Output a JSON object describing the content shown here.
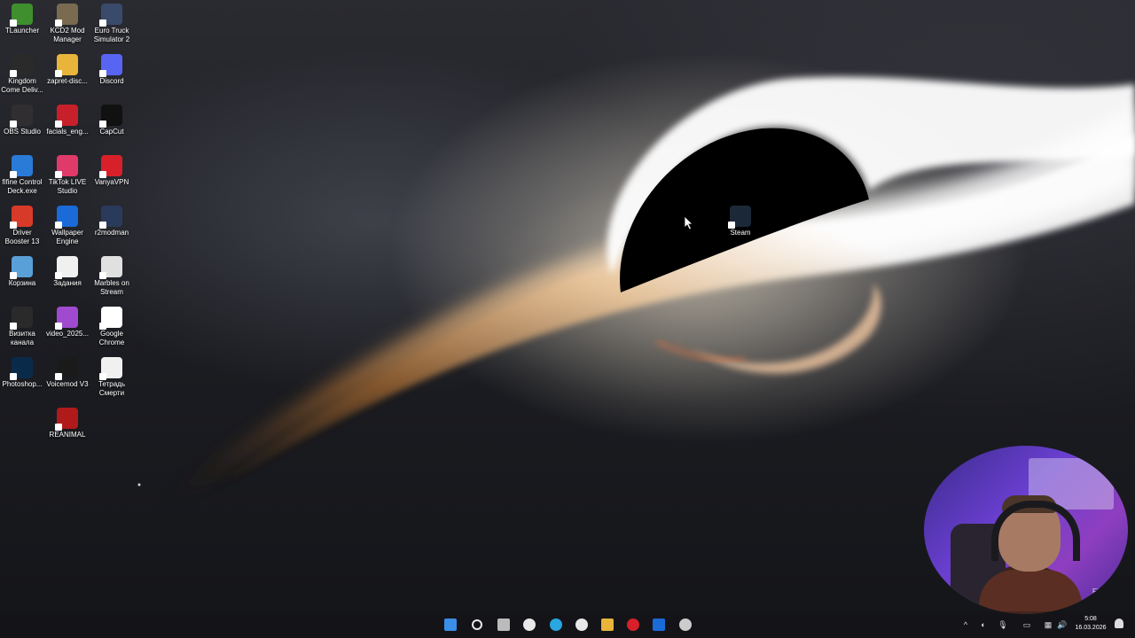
{
  "desktop": {
    "icons": [
      {
        "label": "TLauncher",
        "icon": "tlauncher-icon",
        "color": "#3f8f2f"
      },
      {
        "label": "KCD2 Mod Manager",
        "icon": "gear-icon",
        "color": "#7a6a50"
      },
      {
        "label": "Euro Truck Simulator 2",
        "icon": "truck-icon",
        "color": "#3a4a6a"
      },
      {
        "label": "Kingdom Come Deliv...",
        "icon": "kingdom-come-icon",
        "color": "#2a2a2a"
      },
      {
        "label": "zapret-disc...",
        "icon": "folder-icon",
        "color": "#e8b43a"
      },
      {
        "label": "Discord",
        "icon": "discord-icon",
        "color": "#5865f2"
      },
      {
        "label": "OBS Studio",
        "icon": "obs-icon",
        "color": "#302e31"
      },
      {
        "label": "facials_eng...",
        "icon": "document-icon",
        "color": "#c8202a"
      },
      {
        "label": "CapCut",
        "icon": "capcut-icon",
        "color": "#111111"
      },
      {
        "label": "fifine Control Deck.exe",
        "icon": "fifine-icon",
        "color": "#2a7ad8"
      },
      {
        "label": "TikTok LIVE Studio",
        "icon": "tiktok-icon",
        "color": "#e03a6a"
      },
      {
        "label": "VanyaVPN",
        "icon": "vpn-icon",
        "color": "#d8202a"
      },
      {
        "label": "Driver Booster 13",
        "icon": "driver-booster-icon",
        "color": "#d83a2a"
      },
      {
        "label": "Wallpaper Engine",
        "icon": "wallpaper-engine-icon",
        "color": "#1a6ad8"
      },
      {
        "label": "r2modman",
        "icon": "r2modman-icon",
        "color": "#2a3a5a"
      },
      {
        "label": "Корзина",
        "icon": "recycle-bin-icon",
        "color": "#5aa0d8"
      },
      {
        "label": "Задания",
        "icon": "text-file-icon",
        "color": "#f0f0f0"
      },
      {
        "label": "Marbles on Stream",
        "icon": "marbles-icon",
        "color": "#e0e0e0"
      },
      {
        "label": "Визитка канала",
        "icon": "video-file-icon",
        "color": "#2a2a2a"
      },
      {
        "label": "video_2025...",
        "icon": "video-thumbnail-icon",
        "color": "#a04ad0"
      },
      {
        "label": "Google Chrome",
        "icon": "chrome-icon",
        "color": "#ffffff"
      },
      {
        "label": "Photoshop...",
        "icon": "photoshop-icon",
        "color": "#0a2a4a"
      },
      {
        "label": "Voicemod V3",
        "icon": "voicemod-icon",
        "color": "#1a1a1a"
      },
      {
        "label": "Тетрадь Смерти",
        "icon": "word-document-icon",
        "color": "#f0f0f0"
      },
      {
        "label": "REANIMAL",
        "icon": "reanimal-icon",
        "color": "#b01a1a"
      },
      {
        "label": "Steam",
        "icon": "steam-icon",
        "color": "#1b2838"
      }
    ]
  },
  "taskbar": {
    "items": [
      {
        "name": "start",
        "icon": "windows-start-icon"
      },
      {
        "name": "search",
        "icon": "search-icon"
      },
      {
        "name": "task-view",
        "icon": "task-view-icon"
      },
      {
        "name": "chrome",
        "icon": "chrome-icon"
      },
      {
        "name": "telegram",
        "icon": "telegram-icon"
      },
      {
        "name": "yandex-browser",
        "icon": "yandex-icon"
      },
      {
        "name": "file-explorer",
        "icon": "folder-icon"
      },
      {
        "name": "red-app",
        "icon": "red-app-icon"
      },
      {
        "name": "wallpaper-engine",
        "icon": "wallpaper-engine-icon"
      },
      {
        "name": "steam",
        "icon": "steam-icon"
      }
    ],
    "tray": [
      "chevron-up-icon",
      "headset-icon",
      "microphone-icon",
      "battery-icon",
      "network-icon",
      "speaker-icon"
    ],
    "time": "5:08",
    "date": "16.03.2026"
  },
  "webcam": {
    "caption": "Finity"
  }
}
